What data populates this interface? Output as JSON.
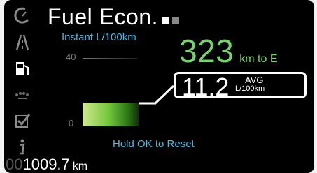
{
  "screen": {
    "title": "Fuel Econ.",
    "subtitle": "Instant L/100km",
    "range": {
      "value": "323",
      "unit": "km to E"
    },
    "gauge": {
      "max_label": "40",
      "min_label": "0",
      "current_fraction": 0.28
    },
    "average": {
      "value": "11.2",
      "label_top": "AVG",
      "label_bottom": "L/100km"
    },
    "hint": "Hold OK to Reset",
    "odometer": {
      "leading_zeros": "00",
      "value": "1009.7",
      "unit": "km"
    }
  },
  "pager": {
    "pages": 2,
    "active": 1
  },
  "sidebar": {
    "icons": [
      "tachometer-icon",
      "road-icon",
      "fuel-pump-icon",
      "gauge-dots-icon",
      "checkbox-icon",
      "info-icon"
    ]
  },
  "colors": {
    "background": "#000000",
    "blue_label": "#4ab8df",
    "green_value": "#77d36f",
    "bar_light": "#cfe98e",
    "bar_dark": "#142e0b"
  }
}
